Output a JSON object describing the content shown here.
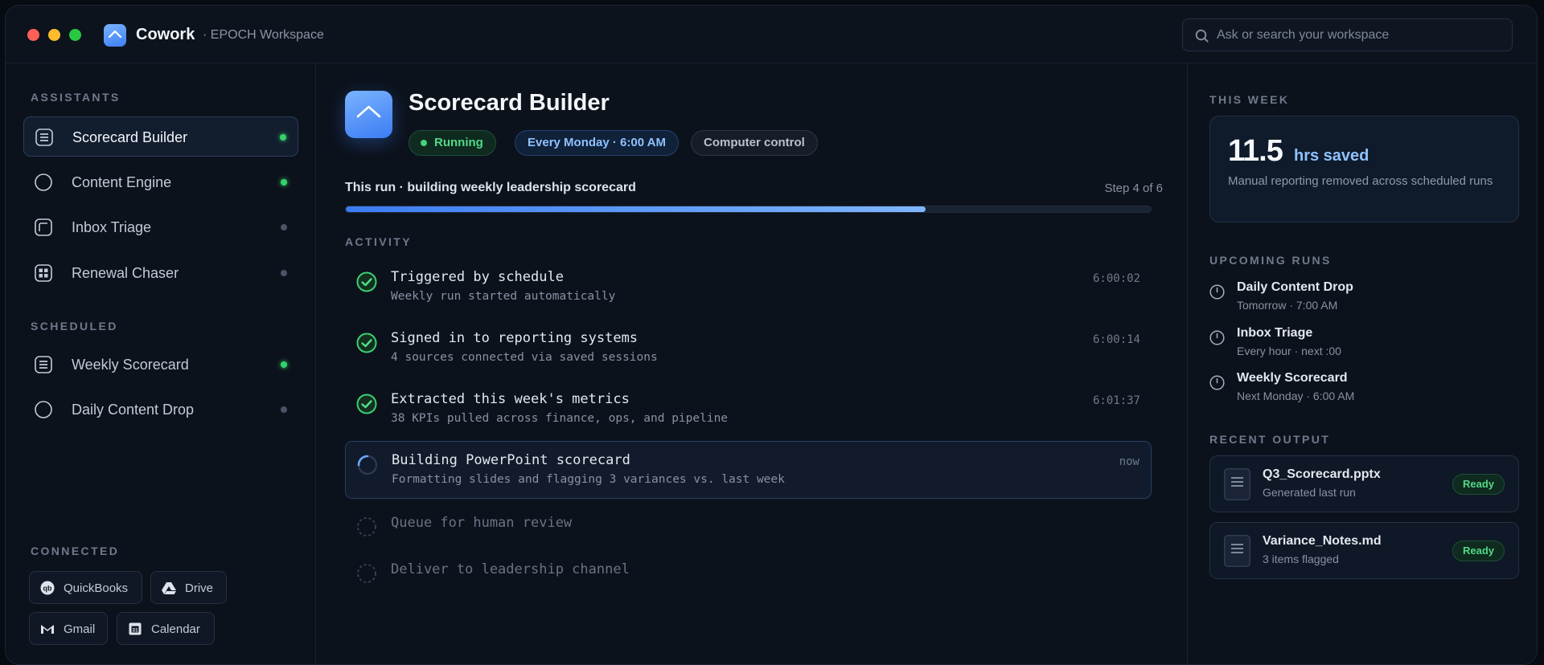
{
  "titlebar": {
    "app_name": "Cowork",
    "workspace": "· EPOCH Workspace",
    "search_placeholder": "Ask or search your workspace"
  },
  "sidebar": {
    "assistants_label": "ASSISTANTS",
    "assistants": [
      {
        "label": "Scorecard Builder",
        "icon": "list-icon",
        "active": true,
        "status": "on"
      },
      {
        "label": "Content Engine",
        "icon": "circle-icon",
        "active": false,
        "status": "on"
      },
      {
        "label": "Inbox Triage",
        "icon": "inbox-icon",
        "active": false,
        "status": "off"
      },
      {
        "label": "Renewal Chaser",
        "icon": "grid-icon",
        "active": false,
        "status": "off"
      }
    ],
    "scheduled_label": "SCHEDULED",
    "scheduled": [
      {
        "label": "Weekly Scorecard",
        "icon": "list-icon",
        "status": "on"
      },
      {
        "label": "Daily Content Drop",
        "icon": "circle-icon",
        "status": "off"
      }
    ],
    "connected_label": "CONNECTED",
    "connected": [
      {
        "label": "QuickBooks",
        "icon": "quickbooks-icon"
      },
      {
        "label": "Drive",
        "icon": "drive-icon"
      },
      {
        "label": "Gmail",
        "icon": "gmail-icon"
      },
      {
        "label": "Calendar",
        "icon": "calendar-icon"
      }
    ]
  },
  "main": {
    "title": "Scorecard Builder",
    "pills": {
      "status": "Running",
      "schedule": "Every Monday · 6:00 AM",
      "mode": "Computer control"
    },
    "run_label": "This run · building weekly leadership scorecard",
    "step_label": "Step 4 of 6",
    "progress_fraction": 0.72,
    "activity_label": "ACTIVITY",
    "activity": [
      {
        "title": "Triggered by schedule",
        "detail": "Weekly run started automatically",
        "time": "6:00:02",
        "state": "done"
      },
      {
        "title": "Signed in to reporting systems",
        "detail": "4 sources connected via saved sessions",
        "time": "6:00:14",
        "state": "done"
      },
      {
        "title": "Extracted this week's metrics",
        "detail": "38 KPIs pulled across finance, ops, and pipeline",
        "time": "6:01:37",
        "state": "done"
      },
      {
        "title": "Building PowerPoint scorecard",
        "detail": "Formatting slides and flagging 3 variances vs. last week",
        "time": "now",
        "state": "current"
      },
      {
        "title": "Queue for human review",
        "state": "pending"
      },
      {
        "title": "Deliver to leadership channel",
        "state": "pending"
      }
    ]
  },
  "right": {
    "week_label": "THIS WEEK",
    "stat_value": "11.5",
    "stat_unit": "hrs saved",
    "stat_desc": "Manual reporting removed across scheduled runs",
    "upcoming_label": "UPCOMING RUNS",
    "upcoming": [
      {
        "title": "Daily Content Drop",
        "when": "Tomorrow · 7:00 AM"
      },
      {
        "title": "Inbox Triage",
        "when": "Every hour · next :00"
      },
      {
        "title": "Weekly Scorecard",
        "when": "Next Monday · 6:00 AM"
      }
    ],
    "output_label": "RECENT OUTPUT",
    "outputs": [
      {
        "name": "Q3_Scorecard.pptx",
        "detail": "Generated last run",
        "badge": "Ready"
      },
      {
        "name": "Variance_Notes.md",
        "detail": "3 items flagged",
        "badge": "Ready"
      }
    ]
  },
  "colors": {
    "accent": "#3b7cf3",
    "success": "#34d36a",
    "background": "#0c121c"
  }
}
